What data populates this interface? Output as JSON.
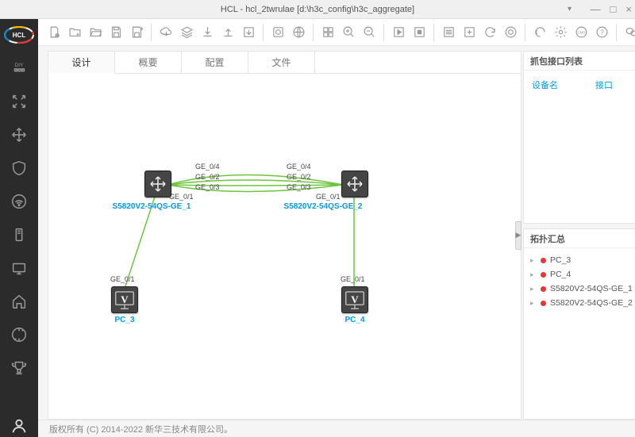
{
  "window": {
    "title": "HCL - hcl_2twrulae [d:\\h3c_config\\h3c_aggregate]",
    "drop": "▾",
    "min": "—",
    "max": "□",
    "close": "×"
  },
  "tabs": {
    "design": "设计",
    "overview": "概要",
    "config": "配置",
    "file": "文件"
  },
  "devices": {
    "sw1": {
      "label": "S5820V2-54QS-GE_1"
    },
    "sw2": {
      "label": "S5820V2-54QS-GE_2"
    },
    "pc3": {
      "label": "PC_3"
    },
    "pc4": {
      "label": "PC_4"
    }
  },
  "ports": {
    "ge01_a": "GE_0/1",
    "ge01_d": "GE_0/1",
    "ge02_l": "GE_0/2",
    "ge03_l": "GE_0/3",
    "ge04_l": "GE_0/4",
    "ge02_r": "GE_0/2",
    "ge03_r": "GE_0/3",
    "ge04_r": "GE_0/4",
    "ge01_l": "GE_0/1",
    "ge01_r": "GE_0/1"
  },
  "rpanel": {
    "capture_title": "抓包接口列表",
    "col_dev": "设备名",
    "col_if": "接口",
    "topo_title": "拓扑汇总",
    "items": [
      "PC_3",
      "PC_4",
      "S5820V2-54QS-GE_1",
      "S5820V2-54QS-GE_2"
    ]
  },
  "footer": "版权所有 (C) 2014-2022 新华三技术有限公司。"
}
